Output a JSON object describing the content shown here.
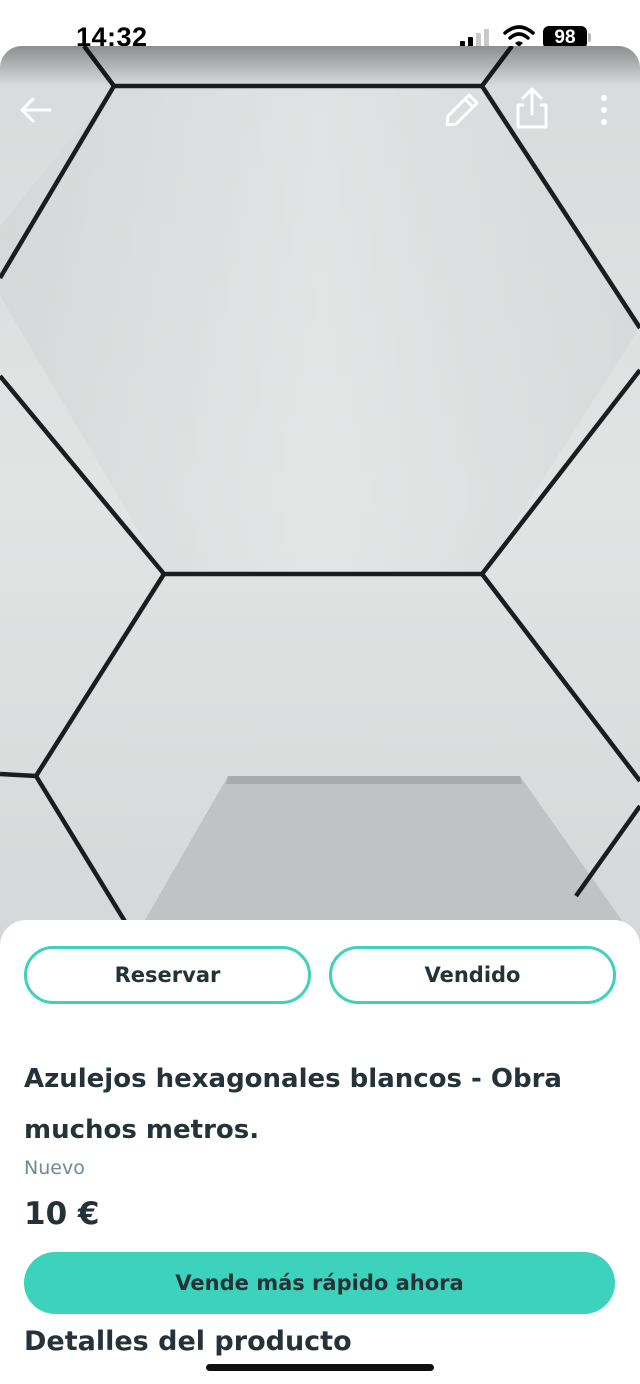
{
  "status_bar": {
    "time": "14:32",
    "battery": "98",
    "icons": [
      "signal-icon",
      "wifi-icon",
      "battery-icon"
    ]
  },
  "top_bar": {
    "icons": [
      "back-arrow-icon",
      "pencil-icon",
      "share-icon",
      "more-vertical-icon"
    ]
  },
  "actions": {
    "reserve_label": "Reservar",
    "sold_label": "Vendido"
  },
  "product": {
    "title": "Azulejos hexagonales blancos - Obra muchos metros.",
    "condition": "Nuevo",
    "price": "10 €"
  },
  "promo": {
    "sell_faster_label": "Vende más rápido ahora"
  },
  "sections": {
    "details_heading": "Detalles del producto"
  },
  "colors": {
    "accent": "#3dd2bb",
    "text": "#253238",
    "muted": "#6f8a93"
  }
}
